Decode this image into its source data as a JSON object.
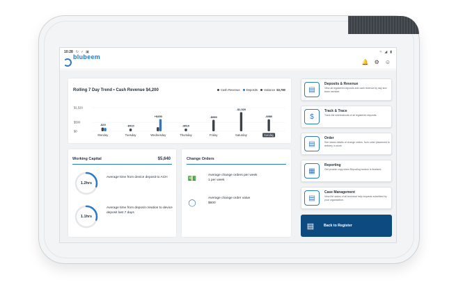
{
  "status_bar": {
    "time": "10:28",
    "left_icons": [
      "sync-icon",
      "check-icon",
      "image-icon"
    ],
    "right_icons": [
      "wifi-icon",
      "signal-icon",
      "battery-icon"
    ]
  },
  "header": {
    "brand": "blubeem",
    "brand_sub": "solutions",
    "icons": [
      "bell-icon",
      "gear-icon",
      "user-icon"
    ]
  },
  "trend": {
    "title": "Rolling 7 Day Trend • Cash Revenue $4,200",
    "legend": {
      "cash_revenue": "Cash Revenue",
      "deposits": "Deposits",
      "variance": "Variance",
      "variance_value": "$3,780"
    },
    "colors": {
      "cash": "#3c4249",
      "deposits": "#2b78c5",
      "selected_tab": "#3c4249"
    }
  },
  "chart_data": {
    "type": "bar",
    "categories": [
      "Monday",
      "Tuesday",
      "Wednesday",
      "Thursday",
      "Friday",
      "Saturday",
      "Sunday"
    ],
    "series": [
      {
        "name": "Cash Revenue",
        "values": [
          210,
          150,
          230,
          150,
          640,
          1070,
          670
        ]
      },
      {
        "name": "Deposits",
        "values": [
          190,
          0,
          680,
          0,
          0,
          0,
          0
        ]
      }
    ],
    "data_labels": [
      "-$20",
      "-$510",
      "+$450",
      "-$510",
      "-$980",
      "-$1,520",
      "-$980"
    ],
    "yticks": [
      {
        "value": 1320,
        "label": "$1,520"
      },
      {
        "value": 500,
        "label": "$500"
      },
      {
        "value": 0,
        "label": "$0"
      }
    ],
    "ylim": [
      0,
      1400
    ],
    "selected_category": "Sunday"
  },
  "working_capital": {
    "title": "Working Capital",
    "value": "$5,640",
    "items": [
      {
        "ring_label": "1.2hrs",
        "progress": 0.3,
        "desc": "Average time from device deposit to ACH"
      },
      {
        "ring_label": "1.1hrs",
        "progress": 0.3,
        "desc": "Average time from deposit creation to device deposit last 7 days"
      }
    ]
  },
  "change_orders": {
    "title": "Change Orders",
    "items": [
      {
        "icon": "money-stack-icon",
        "desc": "Average change orders per week",
        "value": "1 per week"
      },
      {
        "icon": "coins-icon",
        "desc": "Average change order value",
        "value": "$600"
      }
    ]
  },
  "menu": [
    {
      "icon": "deposit-icon",
      "title": "Deposits & Revenue",
      "desc": "View all registered deposits and cash revenue by day and team member."
    },
    {
      "icon": "dollar-location-icon",
      "title": "Track & Trace",
      "desc": "Track the whereabouts of all registered deposits."
    },
    {
      "icon": "order-document-icon",
      "title": "Order",
      "desc": "See status details of change orders, from order placement to delivery in-store."
    },
    {
      "icon": "reporting-icon",
      "title": "Reporting",
      "desc": "Get provide copy when Reporting section is finalized."
    },
    {
      "icon": "case-management-icon",
      "title": "Case Management",
      "desc": "View the status of all technical help requests submitted by your organization."
    }
  ],
  "back_button": {
    "icon": "register-icon",
    "label": "Back to Register"
  }
}
